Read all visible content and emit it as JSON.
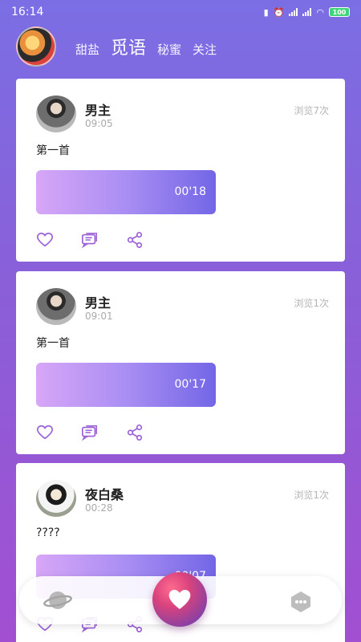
{
  "status_bar": {
    "time": "16:14",
    "battery": "100"
  },
  "header": {
    "tabs": [
      {
        "label": "甜盐",
        "active": false
      },
      {
        "label": "觅语",
        "active": true
      },
      {
        "label": "秘蜜",
        "active": false
      },
      {
        "label": "关注",
        "active": false
      }
    ]
  },
  "posts": [
    {
      "author": "男主",
      "time": "09:05",
      "views": "浏览7次",
      "text": "第一首",
      "duration": "00'18"
    },
    {
      "author": "男主",
      "time": "09:01",
      "views": "浏览1次",
      "text": "第一首",
      "duration": "00'17"
    },
    {
      "author": "夜白桑",
      "time": "00:28",
      "views": "浏览1次",
      "text": "????",
      "duration": "00'07"
    }
  ],
  "icons": {
    "like": "heart-outline-icon",
    "comment": "comment-icon",
    "share": "share-icon",
    "nav_left": "planet-icon",
    "nav_center": "heart-icon",
    "nav_right": "more-dots-icon"
  },
  "colors": {
    "accent": "#7b6ee4",
    "audio_gradient_start": "#d7a6f7",
    "audio_gradient_end": "#7366e6",
    "like_icon": "#8a5fd8"
  }
}
